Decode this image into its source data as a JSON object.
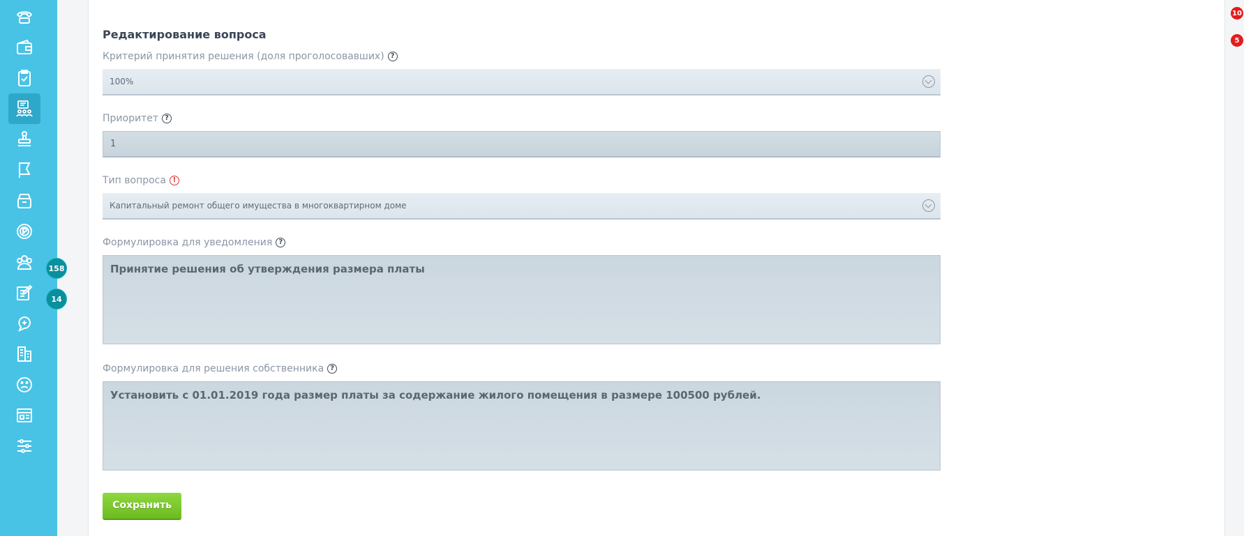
{
  "form": {
    "title": "Редактирование вопроса",
    "criterion": {
      "label": "Критерий принятия решения (доля проголосовавших)",
      "value": "100%"
    },
    "priority": {
      "label": "Приоритет",
      "value": "1"
    },
    "type": {
      "label": "Тип вопроса",
      "value": "Капитальный ремонт общего имущества в многоквартирном доме"
    },
    "notice_wording": {
      "label": "Формулировка для уведомления",
      "value": "Принятие решения об утверждения размера платы"
    },
    "owner_wording": {
      "label": "Формулировка для решения собственника",
      "value": "Установить с 01.01.2019 года размер платы за содержание жилого помещения в размере 100500 рублей."
    },
    "save_label": "Сохранить"
  },
  "sidebar": {
    "items": [
      {
        "icon": "phone-icon"
      },
      {
        "icon": "wallet-icon"
      },
      {
        "icon": "clipboard-check-icon"
      },
      {
        "icon": "voting-meeting-icon",
        "active": true
      },
      {
        "icon": "stamp-icon"
      },
      {
        "icon": "flag-icon"
      },
      {
        "icon": "archive-icon"
      },
      {
        "icon": "ruble-coin-icon"
      },
      {
        "icon": "users-icon",
        "badge": "158"
      },
      {
        "icon": "edit-document-icon",
        "badge": "14"
      },
      {
        "icon": "chat-add-icon"
      },
      {
        "icon": "building-icon"
      },
      {
        "icon": "sad-face-icon"
      },
      {
        "icon": "news-icon"
      },
      {
        "icon": "sliders-icon"
      }
    ]
  },
  "notifications": {
    "top": "10",
    "second": "5"
  },
  "colors": {
    "sidebar": "#48c3e6",
    "accent_green": "#7ac72b",
    "badge_teal": "#0a8f9c",
    "badge_red": "#e41c1c"
  }
}
